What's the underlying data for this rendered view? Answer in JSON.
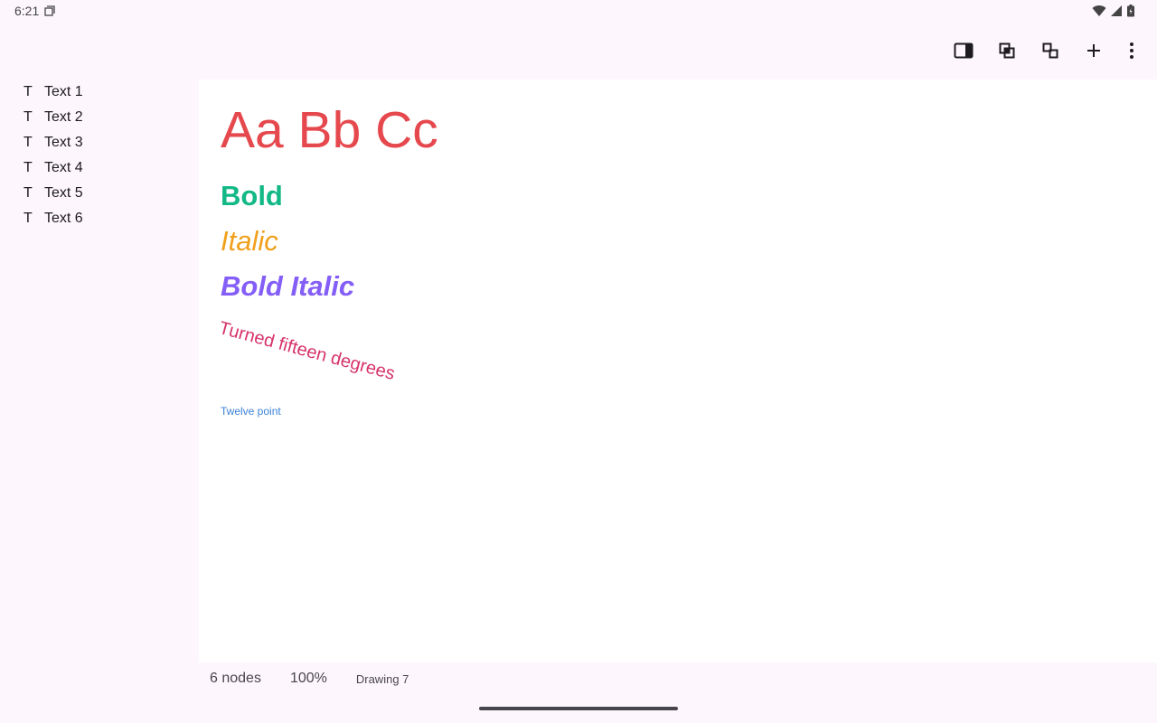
{
  "status": {
    "time": "6:21",
    "icons": [
      "notification-icon",
      "wifi-icon",
      "signal-icon",
      "battery-icon"
    ]
  },
  "toolbar": {
    "icons": [
      "side-panel-icon",
      "bring-forward-icon",
      "send-backward-icon",
      "add-icon",
      "more-vert-icon"
    ]
  },
  "sidebar": {
    "items": [
      {
        "icon": "T",
        "label": "Text 1"
      },
      {
        "icon": "T",
        "label": "Text 2"
      },
      {
        "icon": "T",
        "label": "Text 3"
      },
      {
        "icon": "T",
        "label": "Text 4"
      },
      {
        "icon": "T",
        "label": "Text 5"
      },
      {
        "icon": "T",
        "label": "Text 6"
      }
    ]
  },
  "canvas": {
    "texts": [
      {
        "text": "Aa Bb Cc",
        "color": "#e5484d"
      },
      {
        "text": "Bold",
        "color": "#12b886"
      },
      {
        "text": "Italic",
        "color": "#f0a01c"
      },
      {
        "text": "Bold Italic",
        "color": "#845ef7"
      },
      {
        "text": "Turned fifteen degrees",
        "color": "#d6336c"
      },
      {
        "text": "Twelve point",
        "color": "#3b82d6"
      }
    ]
  },
  "footer": {
    "nodes": "6 nodes",
    "zoom": "100%",
    "drawing": "Drawing 7"
  }
}
